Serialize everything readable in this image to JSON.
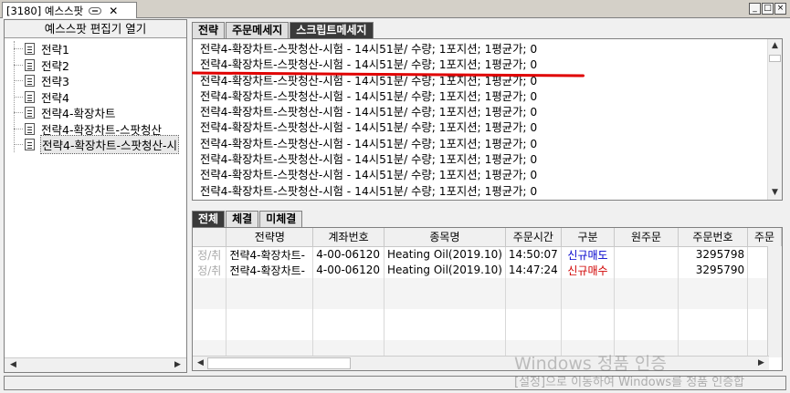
{
  "window": {
    "tab_title": "[3180] 예스스팟",
    "buttons": [
      "_",
      "□",
      "×"
    ]
  },
  "sidebar": {
    "header": "예스스팟 편집기 열기",
    "items": [
      {
        "label": "전략1"
      },
      {
        "label": "전략2"
      },
      {
        "label": "전략3"
      },
      {
        "label": "전략4"
      },
      {
        "label": "전략4-확장차트"
      },
      {
        "label": "전략4-확장차트-스팟청산"
      },
      {
        "label": "전략4-확장차트-스팟청산-시"
      }
    ],
    "selected_index": 6
  },
  "message_tabs": [
    "전략",
    "주문메세지",
    "스크립트메세지"
  ],
  "message_active": 2,
  "messages": [
    "전략4-확장차트-스팟청산-시험 - 14시51분/ 수량; 1포지션; 1평균가; 0",
    "전략4-확장차트-스팟청산-시험 - 14시51분/ 수량; 1포지션; 1평균가; 0",
    "전략4-확장차트-스팟청산-시험 - 14시51분/ 수량; 1포지션; 1평균가; 0",
    "전략4-확장차트-스팟청산-시험 - 14시51분/ 수량; 1포지션; 1평균가; 0",
    "전략4-확장차트-스팟청산-시험 - 14시51분/ 수량; 1포지션; 1평균가; 0",
    "전략4-확장차트-스팟청산-시험 - 14시51분/ 수량; 1포지션; 1평균가; 0",
    "전략4-확장차트-스팟청산-시험 - 14시51분/ 수량; 1포지션; 1평균가; 0",
    "전략4-확장차트-스팟청산-시험 - 14시51분/ 수량; 1포지션; 1평균가; 0",
    "전략4-확장차트-스팟청산-시험 - 14시51분/ 수량; 1포지션; 1평균가; 0",
    "전략4-확장차트-스팟청산-시험 - 14시51분/ 수량; 1포지션; 1평균가; 0"
  ],
  "order_tabs": [
    "전체",
    "체결",
    "미체결"
  ],
  "order_active": 0,
  "orders": {
    "columns": [
      "",
      "전략명",
      "계좌번호",
      "종목명",
      "주문시간",
      "구분",
      "원주문",
      "주문번호",
      "주문"
    ],
    "rows": [
      {
        "action": "정/취",
        "strategy": "전략4-확장차트-",
        "account": "4-00-06120",
        "symbol": "Heating Oil(2019.10)",
        "time": "14:50:07",
        "side": "신규매도",
        "side_color": "#0000cc",
        "orig": "",
        "order_no": "3295798",
        "extra": ""
      },
      {
        "action": "정/취",
        "strategy": "전략4-확장차트-",
        "account": "4-00-06120",
        "symbol": "Heating Oil(2019.10)",
        "time": "14:47:24",
        "side": "신규매수",
        "side_color": "#d00000",
        "orig": "",
        "order_no": "3295790",
        "extra": ""
      }
    ]
  },
  "watermark": {
    "line1": "Windows 정품 인증",
    "line2": "[설정]으로 이동하여 Windows를 정품 인증합"
  }
}
